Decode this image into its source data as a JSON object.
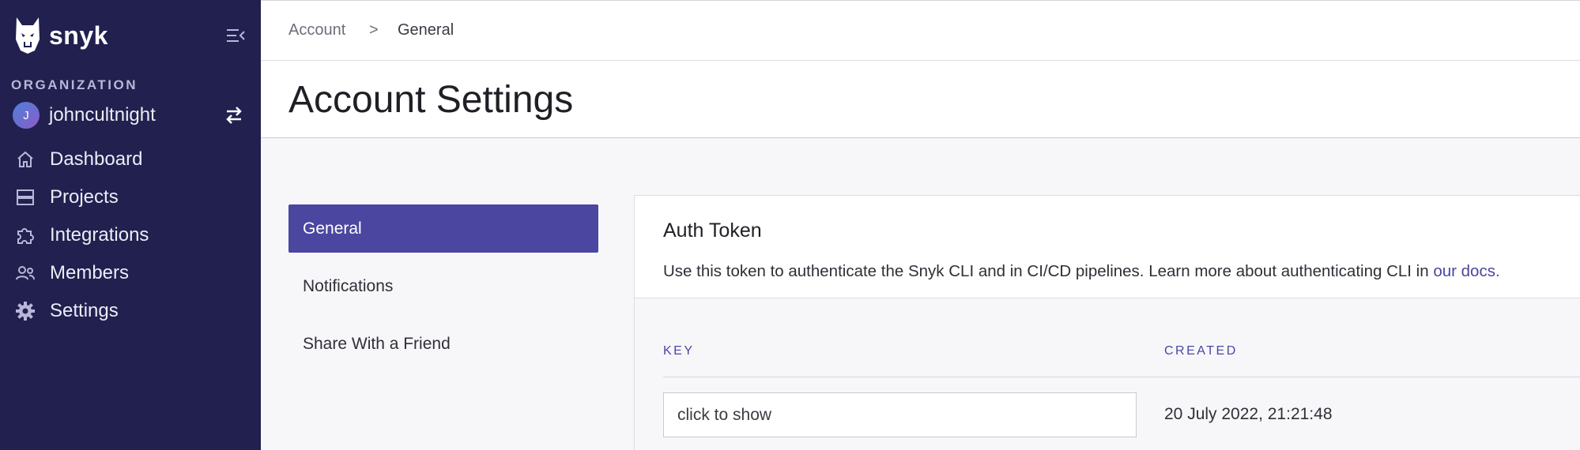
{
  "sidebar": {
    "brand": "snyk",
    "org_label": "ORGANIZATION",
    "org_avatar_initial": "J",
    "org_name": "johncultnight",
    "items": [
      {
        "label": "Dashboard",
        "icon": "home-icon"
      },
      {
        "label": "Projects",
        "icon": "projects-icon"
      },
      {
        "label": "Integrations",
        "icon": "puzzle-icon"
      },
      {
        "label": "Members",
        "icon": "members-icon"
      },
      {
        "label": "Settings",
        "icon": "gear-icon"
      }
    ]
  },
  "breadcrumb": {
    "items": [
      "Account",
      "General"
    ],
    "separator": ">"
  },
  "page_title": "Account Settings",
  "settings_menu": {
    "items": [
      "General",
      "Notifications",
      "Share With a Friend"
    ],
    "active": "General"
  },
  "auth_token": {
    "title": "Auth Token",
    "description": "Use this token to authenticate the Snyk CLI and in CI/CD pipelines. Learn more about authenticating CLI in ",
    "docs_link": "our docs.",
    "columns": {
      "key": "KEY",
      "created": "CREATED"
    },
    "key_value": "click to show",
    "created_value": "20 July 2022, 21:21:48"
  },
  "colors": {
    "sidebar_bg": "#21204f",
    "accent": "#4b46a0",
    "page_bg": "#f7f7fa"
  }
}
